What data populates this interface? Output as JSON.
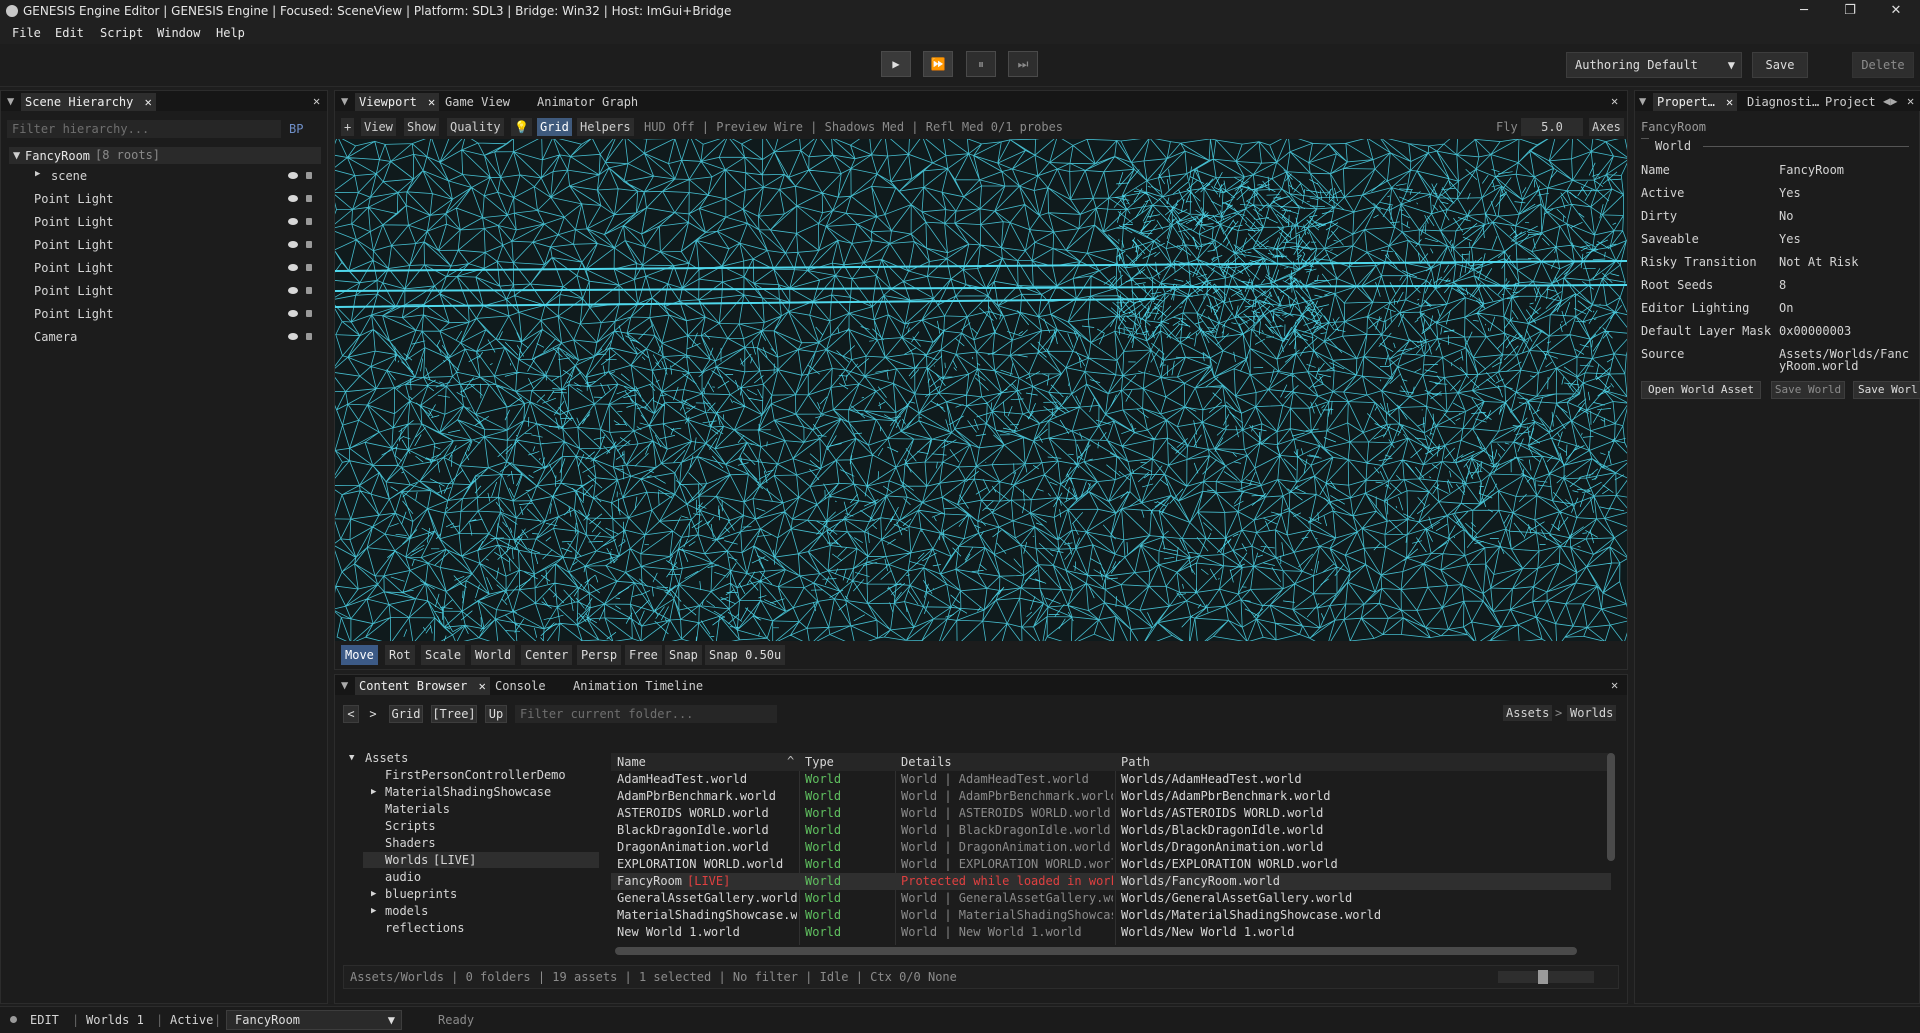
{
  "window": {
    "title": "GENESIS Engine Editor | GENESIS Engine | Focused: SceneView | Platform: SDL3 | Bridge: Win32 | Host: ImGui+Bridge",
    "controls": [
      "─",
      "❐",
      "✕"
    ]
  },
  "menu": [
    "File",
    "Edit",
    "Script",
    "Window",
    "Help"
  ],
  "toolbar": {
    "play_icons": [
      "▶",
      "⏩",
      "⏸",
      "⏭"
    ],
    "layout": "Authoring Default",
    "save": "Save",
    "delete": "Delete"
  },
  "hierarchy": {
    "tab": "Scene Hierarchy",
    "filter_placeholder": "Filter hierarchy...",
    "bp": "BP",
    "root_name": "FancyRoom",
    "root_meta": "[8 roots]",
    "items": [
      "scene",
      "Point Light",
      "Point Light",
      "Point Light",
      "Point Light",
      "Point Light",
      "Point Light",
      "Camera"
    ]
  },
  "viewport": {
    "tabs": [
      "Viewport",
      "Game View",
      "Animator Graph"
    ],
    "bar": [
      "+",
      "View",
      "Show",
      "Quality",
      "💡",
      "Grid",
      "Helpers"
    ],
    "status": "HUD Off | Preview Wire | Shadows Med | Refl Med 0/1 probes",
    "fly_label": "Fly",
    "fly_value": "5.0",
    "axes": "Axes",
    "gizmo": [
      "Move",
      "Rot",
      "Scale",
      "World",
      "Center",
      "Persp",
      "Free",
      "Snap",
      "Snap 0.50u"
    ],
    "wire_color": "#4fd8ec"
  },
  "properties": {
    "tabs": [
      "Propert…",
      "Diagnosti…",
      "Project"
    ],
    "title": "FancyRoom",
    "section": "World",
    "rows": [
      {
        "k": "Name",
        "v": "FancyRoom"
      },
      {
        "k": "Active",
        "v": "Yes"
      },
      {
        "k": "Dirty",
        "v": "No"
      },
      {
        "k": "Saveable",
        "v": "Yes"
      },
      {
        "k": "Risky Transition",
        "v": "Not At Risk"
      },
      {
        "k": "Root Seeds",
        "v": "8"
      },
      {
        "k": "Editor Lighting",
        "v": "On"
      },
      {
        "k": "Default Layer Mask",
        "v": "0x00000003"
      },
      {
        "k": "Source",
        "v": "Assets/Worlds/Fanc",
        "v2": "yRoom.world"
      }
    ],
    "buttons": [
      "Open World Asset",
      "Save World",
      "Save Worl"
    ]
  },
  "content": {
    "tabs": [
      "Content Browser",
      "Console",
      "Animation Timeline"
    ],
    "nav": [
      "<",
      ">",
      "Grid",
      "[Tree]",
      "Up"
    ],
    "filter_placeholder": "Filter current folder...",
    "breadcrumb": [
      "Assets",
      ">",
      "Worlds"
    ],
    "tree": [
      {
        "label": "Assets",
        "arrow": "▼",
        "depth": 0
      },
      {
        "label": "FirstPersonControllerDemo",
        "arrow": "",
        "depth": 1
      },
      {
        "label": "MaterialShadingShowcase",
        "arrow": "▶",
        "depth": 1
      },
      {
        "label": "Materials",
        "arrow": "",
        "depth": 1
      },
      {
        "label": "Scripts",
        "arrow": "",
        "depth": 1
      },
      {
        "label": "Shaders",
        "arrow": "",
        "depth": 1
      },
      {
        "label": "Worlds",
        "tag": "[LIVE]",
        "arrow": "",
        "depth": 1
      },
      {
        "label": "audio",
        "arrow": "",
        "depth": 1
      },
      {
        "label": "blueprints",
        "arrow": "▶",
        "depth": 1
      },
      {
        "label": "models",
        "arrow": "▶",
        "depth": 1
      },
      {
        "label": "reflections",
        "arrow": "",
        "depth": 1
      }
    ],
    "columns": [
      "Name",
      "Type",
      "Details",
      "Path"
    ],
    "sort_icon": "^",
    "rows": [
      {
        "name": "AdamHeadTest.world",
        "type": "World",
        "details": "World | AdamHeadTest.world",
        "path": "Worlds/AdamHeadTest.world"
      },
      {
        "name": "AdamPbrBenchmark.world",
        "type": "World",
        "details": "World | AdamPbrBenchmark.world",
        "path": "Worlds/AdamPbrBenchmark.world"
      },
      {
        "name": "ASTEROIDS WORLD.world",
        "type": "World",
        "details": "World | ASTEROIDS WORLD.world",
        "path": "Worlds/ASTEROIDS WORLD.world"
      },
      {
        "name": "BlackDragonIdle.world",
        "type": "World",
        "details": "World | BlackDragonIdle.world",
        "path": "Worlds/BlackDragonIdle.world"
      },
      {
        "name": "DragonAnimation.world",
        "type": "World",
        "details": "World | DragonAnimation.world",
        "path": "Worlds/DragonAnimation.world"
      },
      {
        "name": "EXPLORATION WORLD.world",
        "type": "World",
        "details": "World | EXPLORATION WORLD.world",
        "path": "Worlds/EXPLORATION WORLD.world"
      },
      {
        "name": "FancyRoom",
        "tag": "[LIVE]",
        "type": "World",
        "details": "Protected while loaded in workspace",
        "path": "Worlds/FancyRoom.world",
        "selected": true
      },
      {
        "name": "GeneralAssetGallery.world",
        "type": "World",
        "details": "World | GeneralAssetGallery.world",
        "path": "Worlds/GeneralAssetGallery.world"
      },
      {
        "name": "MaterialShadingShowcase.world",
        "type": "World",
        "details": "World | MaterialShadingShowcase.world",
        "path": "Worlds/MaterialShadingShowcase.world"
      },
      {
        "name": "New World 1.world",
        "type": "World",
        "details": "World | New World 1.world",
        "path": "Worlds/New World 1.world"
      }
    ],
    "status": "Assets/Worlds | 0 folders | 19 assets | 1 selected | No filter | Idle | Ctx 0/0 None"
  },
  "statusbar": {
    "mode": "EDIT",
    "worlds": "Worlds 1",
    "active": "Active",
    "world_select": "FancyRoom",
    "ready": "Ready"
  }
}
